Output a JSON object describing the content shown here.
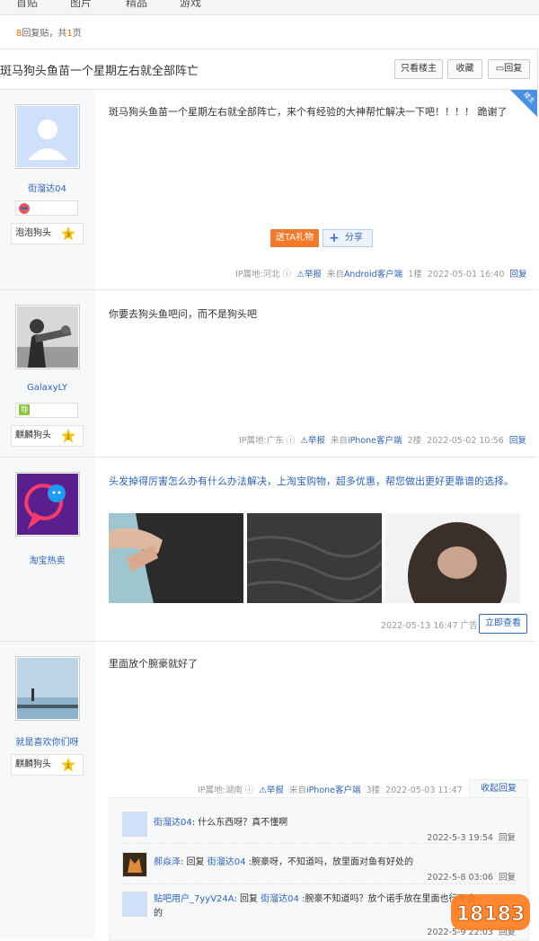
{
  "nav": {
    "tabs": [
      "首贴",
      "图片",
      "精品",
      "游戏"
    ]
  },
  "pageinfo": {
    "count": "8",
    "text1": "回复贴，共",
    "pages": "1",
    "text2": "页"
  },
  "thread": {
    "title": "斑马狗头鱼苗一个星期左右就全部阵亡",
    "buttons": {
      "only_op": "只看楼主",
      "favorite": "收藏",
      "reply": "回复"
    }
  },
  "posts": [
    {
      "corner": "楼主",
      "user": "街溜达04",
      "level_name": "泡泡狗头",
      "level": "3",
      "text": "斑马狗头鱼苗一个星期左右就全部阵亡，来个有经验的大神帮忙解决一下吧！！！！ 跪谢了",
      "gift": "送TA礼物",
      "share": "分享",
      "ip": "IP属地:河北",
      "report": "举报",
      "from_pre": "来自",
      "client": "Android客户端",
      "floor": "1楼",
      "date": "2022-05-01 16:40",
      "reply": "回复"
    },
    {
      "user": "GalaxyLY",
      "level_name": "麒麟狗头",
      "level": "1",
      "text": "你要去狗头鱼吧问，而不是狗头吧",
      "ip": "IP属地:广东",
      "report": "举报",
      "from_pre": "来自",
      "client": "iPhone客户端",
      "floor": "2楼",
      "date": "2022-05-02 10:56",
      "reply": "回复"
    },
    {
      "user": "淘宝热卖",
      "text": "头发掉得厉害怎么办有什么办法解决，上淘宝购物，超多优惠，帮您做出更好更靠谱的选择。",
      "date_ad": "2022-05-13 16:47",
      "ad": "广告",
      "cta": "立即查看"
    },
    {
      "user": "就是喜欢你们呀",
      "level_name": "麒麟狗头",
      "level": "1",
      "text": "里面放个腕豪就好了",
      "ip": "IP属地:湖南",
      "report": "举报",
      "from_pre": "来自",
      "client": "iPhone客户端",
      "floor": "3楼",
      "date": "2022-05-03 11:47",
      "collapse": "收起回复"
    }
  ],
  "replies": [
    {
      "user": "街溜达04",
      "colon": ": ",
      "text": "什么东西呀？真不懂啊",
      "date": "2022-5-3 19:54",
      "reply": "回复"
    },
    {
      "user": "郝焱泽",
      "mid": ": 回复 ",
      "target": "街溜达04",
      "text": " :腕豪呀，不知道吗，放里面对鱼有好处的",
      "date": "2022-5-8 03:06",
      "reply": "回复"
    },
    {
      "user": "贴吧用户_7yyV24A",
      "mid": ": 回复 ",
      "target": "街溜达04",
      "text": " :腕豪不知道吗？放个诺手放在里面也行不会",
      "text2": "的",
      "date": "2022-5-9 22:03",
      "reply": "回复"
    }
  ],
  "watermark": "18183"
}
